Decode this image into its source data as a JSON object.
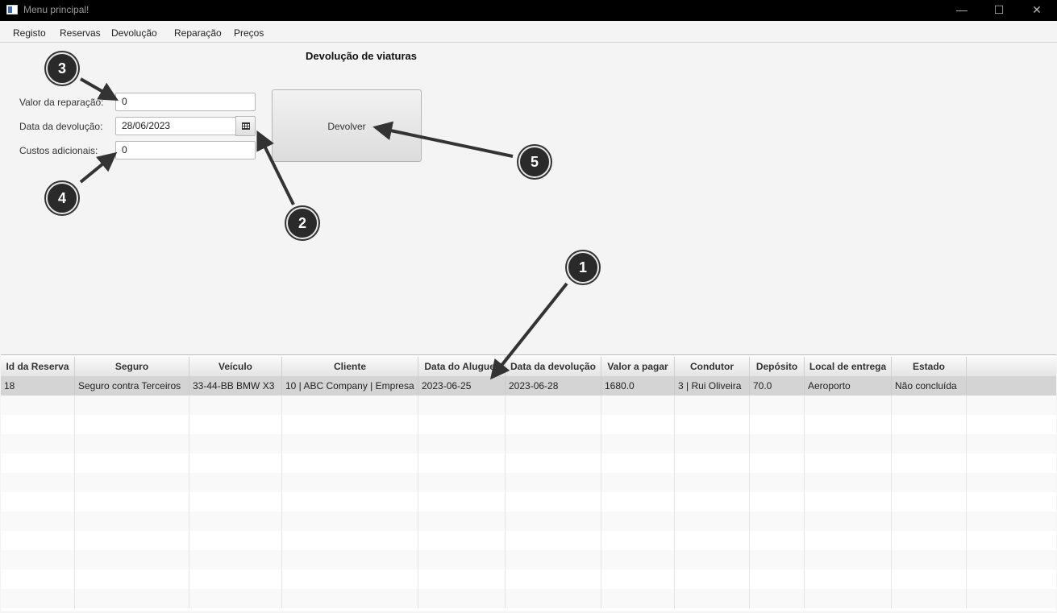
{
  "window": {
    "title": "Menu principal!"
  },
  "title_buttons": {
    "minimize": "—",
    "maximize": "☐",
    "close": "✕"
  },
  "menu": [
    "Registo",
    "Reservas",
    "Devolução",
    "Reparação",
    "Preços"
  ],
  "form": {
    "title": "Devolução de viaturas",
    "repair_label": "Valor da reparação:",
    "repair_value": "0",
    "return_date_label": "Data da devolução:",
    "return_date_value": "28/06/2023",
    "extra_label": "Custos adicionais:",
    "extra_value": "0",
    "submit_label": "Devolver"
  },
  "table": {
    "columns": [
      "Id da Reserva",
      "Seguro",
      "Veículo",
      "Cliente",
      "Data do Aluguer",
      "Data da devolução",
      "Valor a pagar",
      "Condutor",
      "Depósito",
      "Local de entrega",
      "Estado"
    ],
    "rows": [
      [
        "18",
        "Seguro contra Terceiros",
        "33-44-BB BMW X3",
        "10 | ABC Company | Empresa",
        "2023-06-25",
        "2023-06-28",
        "1680.0",
        "3 | Rui Oliveira",
        "70.0",
        "Aeroporto",
        "Não concluída"
      ]
    ]
  },
  "annotations": [
    "1",
    "2",
    "3",
    "4",
    "5"
  ],
  "colors": {
    "titlebar": "#000000",
    "callout": "#2a2a2a",
    "selected_row": "#d4d4d4"
  }
}
